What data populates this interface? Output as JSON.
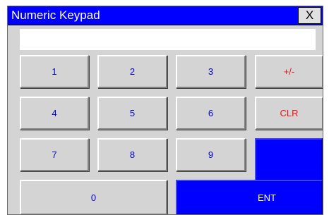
{
  "window": {
    "title": "Numeric Keypad",
    "close_label": "X"
  },
  "display": {
    "value": ""
  },
  "keys": {
    "k1": "1",
    "k2": "2",
    "k3": "3",
    "plus_minus": "+/-",
    "k4": "4",
    "k5": "5",
    "k6": "6",
    "clear": "CLR",
    "k7": "7",
    "k8": "8",
    "k9": "9",
    "k0": "0",
    "enter": "ENT"
  },
  "colors": {
    "title_bar": "#0000ff",
    "digit_text": "#0000cc",
    "function_text": "#ee1111",
    "enter_key": "#0000ff",
    "key_face": "#d4d4d4"
  }
}
